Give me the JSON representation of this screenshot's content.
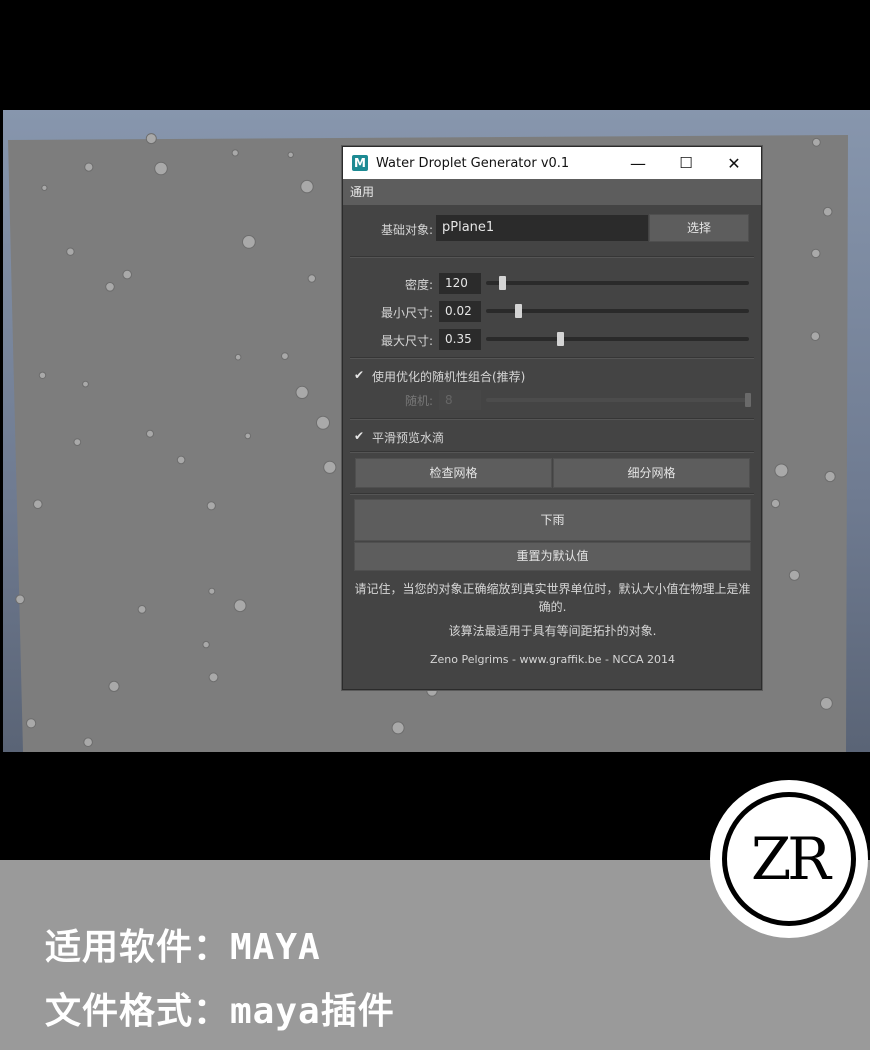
{
  "dialog": {
    "title": "Water Droplet Generator v0.1",
    "app_icon": "M",
    "window_buttons": {
      "minimize": "—",
      "maximize": "☐",
      "close": "✕"
    },
    "menu_label": "通用",
    "base_object": {
      "label": "基础对象:",
      "value": "pPlane1",
      "select_button": "选择"
    },
    "sliders": [
      {
        "label": "密度:",
        "value": "120",
        "level": 0.06
      },
      {
        "label": "最小尺寸:",
        "value": "0.02",
        "level": 0.12
      },
      {
        "label": "最大尺寸:",
        "value": "0.35",
        "level": 0.28
      }
    ],
    "random_combo": {
      "label": "使用优化的随机性组合(推荐)",
      "checked": true
    },
    "random": {
      "label": "随机:",
      "value": "8",
      "enabled": false
    },
    "smooth_preview": {
      "label": "平滑预览水滴",
      "checked": true
    },
    "check_mesh_button": "检查网格",
    "subdivide_mesh_button": "细分网格",
    "rain_button": "下雨",
    "reset_button": "重置为默认值",
    "note_1": "请记住，当您的对象正确缩放到真实世界单位时，默认大小值在物理上是准确的.",
    "note_2": "该算法最适用于具有等间距拓扑的对象.",
    "credits": "Zeno Pelgrims - www.graffik.be - NCCA 2014"
  },
  "caption": {
    "line_1": "适用软件：MAYA",
    "line_2": "文件格式：maya插件"
  },
  "logo": {
    "text": "ZR"
  }
}
